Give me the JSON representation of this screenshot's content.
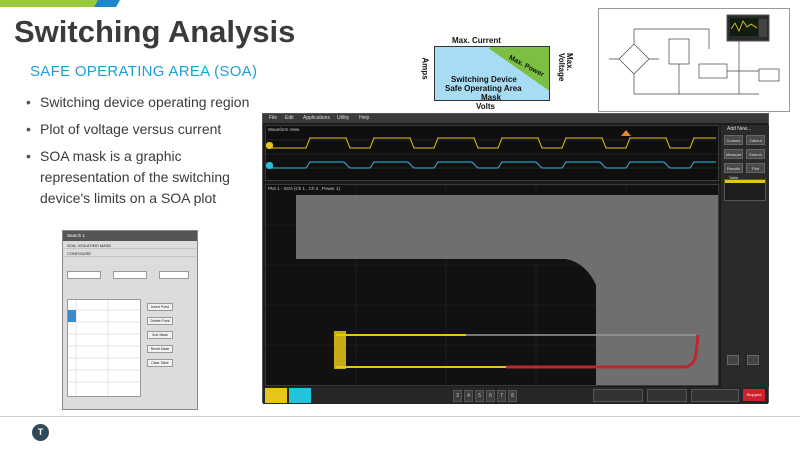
{
  "slide": {
    "title": "Switching Analysis",
    "subtitle": "SAFE OPERATING AREA (SOA)",
    "bullets": [
      "Switching device operating region",
      "Plot of voltage versus current",
      "SOA mask is a graphic representation of the switching device's limits on a SOA plot"
    ],
    "logo_text": "T"
  },
  "soa_diagram": {
    "max_current": "Max. Current",
    "max_power": "Max. Power",
    "max_voltage": "Max. Voltage",
    "amps": "Amps",
    "volts": "Volts",
    "center_line1": "Switching Device",
    "center_line2": "Safe Operating Area",
    "center_line3": "Mask",
    "colors": {
      "area": "#a8dcf4",
      "power_corner": "#7bc043"
    }
  },
  "scope": {
    "menu": [
      "File",
      "Edit",
      "Applications",
      "Utility",
      "Help"
    ],
    "waveform_title": "Waveform View",
    "plot_title": "Plot 1 - SOA (Ch 1 , Ch 2 , Power 1)",
    "add_new": "Add New...",
    "right_buttons": [
      "Cursors",
      "Callout",
      "Measure",
      "Search",
      "Results Table",
      "Plot"
    ],
    "bottom_numbers": [
      "3",
      "4",
      "5",
      "6",
      "7",
      "8"
    ],
    "red_button": "Stopped",
    "colors": {
      "ch1": "#e6c619",
      "ch2": "#22c4dc",
      "mask": "#777777",
      "violation": "#c0262c"
    }
  },
  "settings_panel": {
    "header": "Search 1",
    "rows": [
      "SOA, VIOLATING MASK",
      "CONFIGURE"
    ],
    "buttons": [
      "Insert Point",
      "Delete Point",
      "Sort Mask",
      "Reset Mask",
      "Clear Table"
    ]
  }
}
